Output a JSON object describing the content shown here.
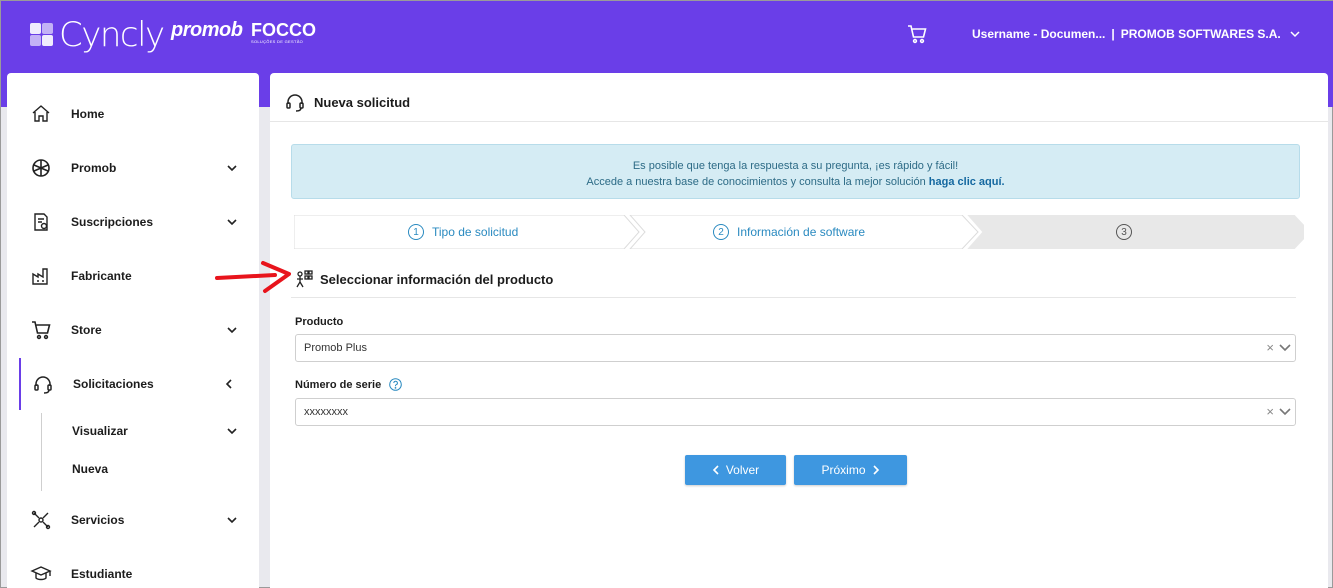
{
  "header": {
    "brand": "Cyncly",
    "partner1": "promob",
    "partner2": "FOCCO",
    "partner2_sub": "SOLUÇÕES DE GESTÃO",
    "user": "Username - Documen...",
    "separator": "|",
    "company": "PROMOB SOFTWARES S.A.",
    "accent": "#6a3ee8"
  },
  "sidebar": {
    "items": [
      {
        "label": "Home",
        "icon": "home-icon"
      },
      {
        "label": "Promob",
        "icon": "promob-icon"
      },
      {
        "label": "Suscripciones",
        "icon": "subscriptions-icon"
      },
      {
        "label": "Fabricante",
        "icon": "factory-icon"
      },
      {
        "label": "Store",
        "icon": "cart-icon"
      },
      {
        "label": "Solicitaciones",
        "icon": "headset-icon"
      },
      {
        "label": "Servicios",
        "icon": "services-icon"
      },
      {
        "label": "Estudiante",
        "icon": "graduation-cap-icon"
      }
    ],
    "sub_items": [
      "Visualizar",
      "Nueva"
    ]
  },
  "main": {
    "title": "Nueva solicitud",
    "info_line1": "Es posible que tenga la respuesta a su pregunta, ¡es rápido y fácil!",
    "info_line2": "Accede a nuestra base de conocimientos y consulta la mejor solución",
    "info_link": "haga clic aquí.",
    "steps": [
      {
        "num": "1",
        "label": "Tipo de solicitud"
      },
      {
        "num": "2",
        "label": "Información de software"
      },
      {
        "num": "3",
        "label": ""
      }
    ],
    "section_title": "Seleccionar información del producto",
    "product_label": "Producto",
    "product_value": "Promob Plus",
    "serial_label": "Número de serie",
    "serial_value": "xxxxxxxx",
    "clear_symbol": "×",
    "back_label": "Volver",
    "next_label": "Próximo"
  }
}
